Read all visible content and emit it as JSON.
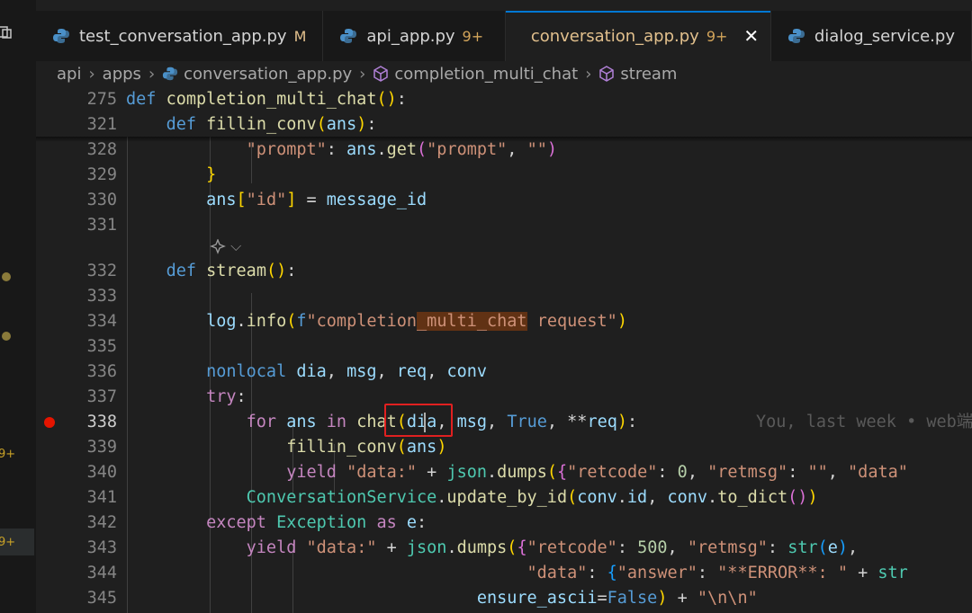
{
  "tabs": [
    {
      "label": "test_conversation_app.py",
      "badge": "M"
    },
    {
      "label": "api_app.py",
      "badge": "9+"
    },
    {
      "label": "conversation_app.py",
      "badge": "9+",
      "close": "✕"
    },
    {
      "label": "dialog_service.py",
      "badge": ""
    }
  ],
  "breadcrumb": [
    "api",
    "apps",
    "conversation_app.py",
    "completion_multi_chat",
    "stream"
  ],
  "activity_badges": [
    "9+",
    "9+"
  ],
  "line_numbers": [
    "275",
    "321",
    "328",
    "329",
    "330",
    "331",
    "332",
    "333",
    "334",
    "335",
    "336",
    "337",
    "338",
    "339",
    "340",
    "341",
    "342",
    "343",
    "344",
    "345"
  ],
  "codelens_chevron": "⌵",
  "blame": "You, last week • web端",
  "colors": {
    "accent": "#0078d4",
    "highlight_box": "#e02020",
    "breakpoint": "#e51400",
    "word_highlight": "#613214"
  }
}
